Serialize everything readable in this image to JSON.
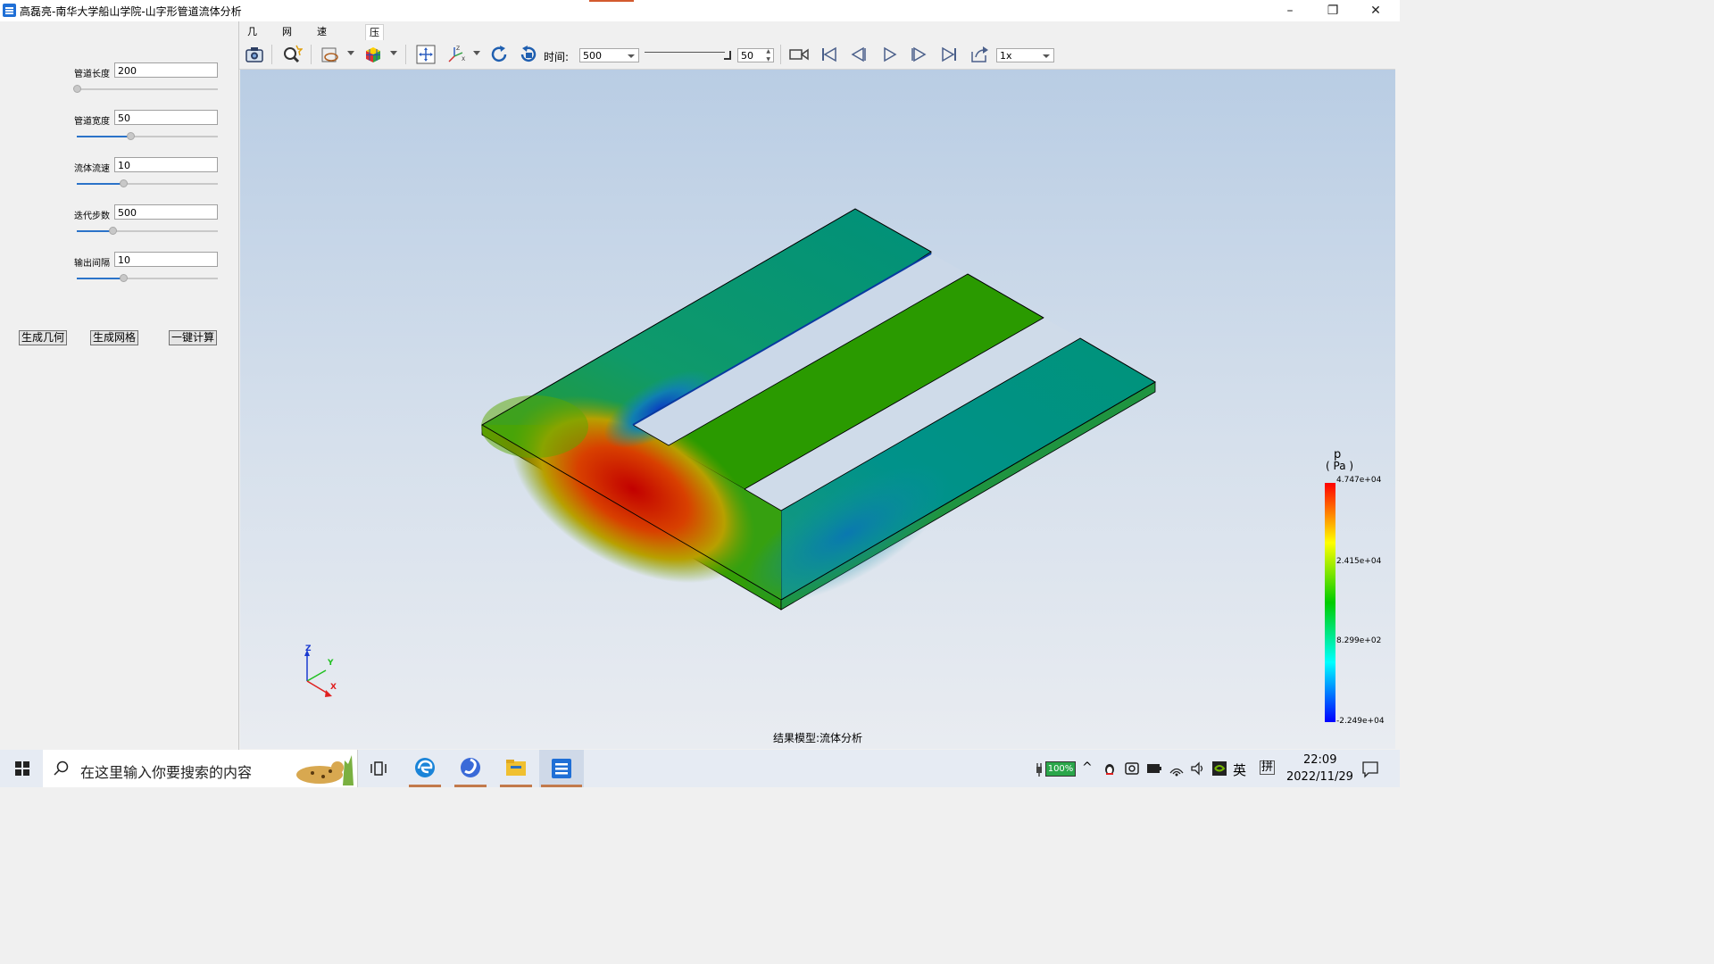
{
  "window": {
    "title": "高磊亮-南华大学船山学院-山字形管道流体分析",
    "minimize": "–",
    "restore": "❐",
    "close": "✕"
  },
  "params": [
    {
      "label": "管道长度",
      "value": "200",
      "slider_fraction": 0.0
    },
    {
      "label": "管道宽度",
      "value": "50",
      "slider_fraction": 0.38
    },
    {
      "label": "流体流速",
      "value": "10",
      "slider_fraction": 0.33
    },
    {
      "label": "迭代步数",
      "value": "500",
      "slider_fraction": 0.25
    },
    {
      "label": "输出间隔",
      "value": "10",
      "slider_fraction": 0.33
    }
  ],
  "buttons": {
    "gen_geometry": "生成几何",
    "gen_mesh": "生成网格",
    "one_click_compute": "一键计算"
  },
  "menu_tabs": [
    "几何",
    "网格",
    "速度云图",
    "压强云图"
  ],
  "active_tab_index": 3,
  "toolbar": {
    "time_label": "时间:",
    "time_value": "500",
    "frame_value": "50",
    "speed_value": "1x",
    "icons": [
      "camera-icon",
      "zoom-wand-icon",
      "display-mode-icon",
      "color-cube-icon",
      "fit-view-icon",
      "axes-icon",
      "rotate-cw-icon",
      "rotate-ccw-icon",
      "video-record-icon",
      "skip-first-icon",
      "step-back-icon",
      "play-icon",
      "step-forward-icon",
      "skip-last-icon",
      "export-icon"
    ]
  },
  "viewport": {
    "model_status": "结果模型:流体分析",
    "axis_labels": {
      "z": "Z",
      "y": "Y",
      "x": "X"
    }
  },
  "legend": {
    "title": "p",
    "unit": "( Pa )",
    "ticks": [
      "4.747e+04",
      "2.415e+04",
      "8.299e+02",
      "-2.249e+04"
    ],
    "colors": [
      "#ff0000",
      "#ffff00",
      "#00cc00",
      "#00ffff",
      "#0000ff"
    ]
  },
  "taskbar": {
    "search_placeholder": "在这里输入你要搜索的内容",
    "battery": "100%",
    "ime_lang": "英",
    "ime_mode": "拼",
    "time": "22:09",
    "date": "2022/11/29"
  }
}
